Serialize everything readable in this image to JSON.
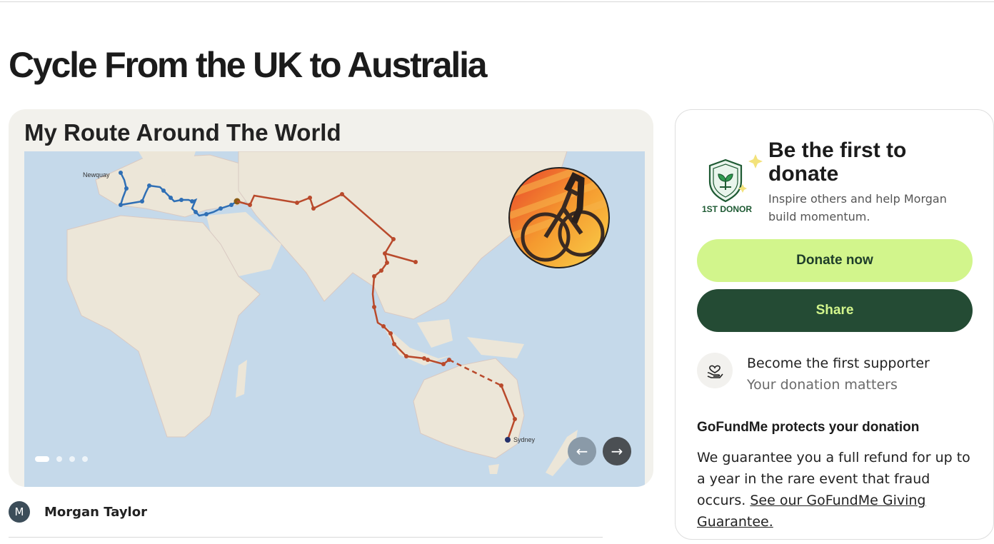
{
  "page": {
    "title": "Cycle From the UK to Australia"
  },
  "media": {
    "heading": "My Route Around The World",
    "map_labels": {
      "start": "Newquay",
      "end": "Sydney"
    },
    "slides": 4,
    "active_slide": 1,
    "prev_icon": "arrow-left-icon",
    "next_icon": "arrow-right-icon"
  },
  "organizer": {
    "initial": "M",
    "name": "Morgan Taylor"
  },
  "card": {
    "badge_label": "1ST DONOR",
    "title": "Be the first to donate",
    "subtitle": "Inspire others and help Morgan build momentum.",
    "donate_label": "Donate now",
    "share_label": "Share",
    "supporter_title": "Become the first supporter",
    "supporter_sub": "Your donation matters",
    "protect_title": "GoFundMe protects your donation",
    "protect_body": "We guarantee you a full refund for up to a year in the rare event that fraud occurs.",
    "protect_link": "See our GoFundMe Giving Guarantee."
  },
  "colors": {
    "donate_bg": "#d2f58c",
    "share_bg": "#244b34",
    "route_europe": "#2f6fb5",
    "route_asia": "#b94a2c"
  }
}
